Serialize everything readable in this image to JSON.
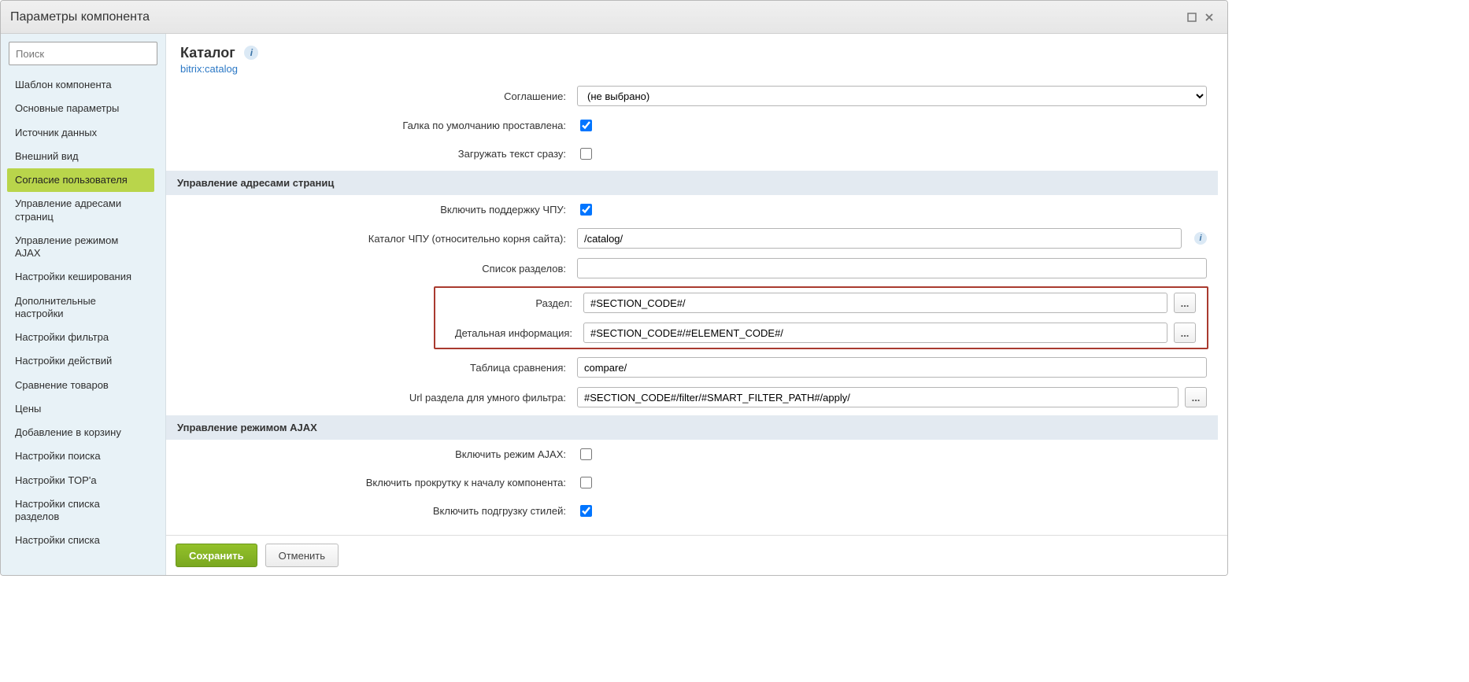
{
  "window": {
    "title": "Параметры компонента",
    "maximize_tooltip": "Развернуть",
    "close_tooltip": "Закрыть"
  },
  "search": {
    "placeholder": "Поиск"
  },
  "sidebar": {
    "items": [
      {
        "label": "Шаблон компонента"
      },
      {
        "label": "Основные параметры"
      },
      {
        "label": "Источник данных"
      },
      {
        "label": "Внешний вид"
      },
      {
        "label": "Согласие пользователя",
        "active": true
      },
      {
        "label": "Управление адресами страниц"
      },
      {
        "label": "Управление режимом AJAX"
      },
      {
        "label": "Настройки кеширования"
      },
      {
        "label": "Дополнительные настройки"
      },
      {
        "label": "Настройки фильтра"
      },
      {
        "label": "Настройки действий"
      },
      {
        "label": "Сравнение товаров"
      },
      {
        "label": "Цены"
      },
      {
        "label": "Добавление в корзину"
      },
      {
        "label": "Настройки поиска"
      },
      {
        "label": "Настройки TOP'a"
      },
      {
        "label": "Настройки списка разделов"
      },
      {
        "label": "Настройки списка"
      }
    ]
  },
  "header": {
    "title": "Каталог",
    "component": "bitrix:catalog"
  },
  "consent": {
    "agreement_label": "Соглашение:",
    "agreement_value": "(не выбрано)",
    "default_checked_label": "Галка по умолчанию проставлена:",
    "load_immediately_label": "Загружать текст сразу:"
  },
  "url_section": {
    "heading": "Управление адресами страниц",
    "sef_enable_label": "Включить поддержку ЧПУ:",
    "sef_folder_label": "Каталог ЧПУ (относительно корня сайта):",
    "sef_folder_value": "/catalog/",
    "sections_label": "Список разделов:",
    "sections_value": "",
    "section_label": "Раздел:",
    "section_value": "#SECTION_CODE#/",
    "detail_label": "Детальная информация:",
    "detail_value": "#SECTION_CODE#/#ELEMENT_CODE#/",
    "compare_label": "Таблица сравнения:",
    "compare_value": "compare/",
    "smart_filter_label": "Url раздела для умного фильтра:",
    "smart_filter_value": "#SECTION_CODE#/filter/#SMART_FILTER_PATH#/apply/"
  },
  "ajax_section": {
    "heading": "Управление режимом AJAX",
    "enable_label": "Включить режим AJAX:",
    "scroll_label": "Включить прокрутку к началу компонента:",
    "styles_label": "Включить подгрузку стилей:"
  },
  "footer": {
    "save": "Сохранить",
    "cancel": "Отменить"
  },
  "icons": {
    "dots": "..."
  }
}
